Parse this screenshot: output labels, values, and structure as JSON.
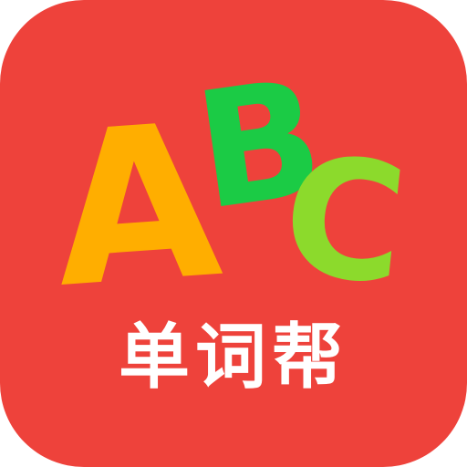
{
  "app_icon": {
    "background_color": "#EE423B",
    "letters": [
      {
        "char": "A",
        "color": "#FFAE00"
      },
      {
        "char": "B",
        "color": "#1BCB45"
      },
      {
        "char": "C",
        "color": "#8CDA2C"
      }
    ],
    "name": "单词帮",
    "name_color": "#FFFFFF"
  }
}
